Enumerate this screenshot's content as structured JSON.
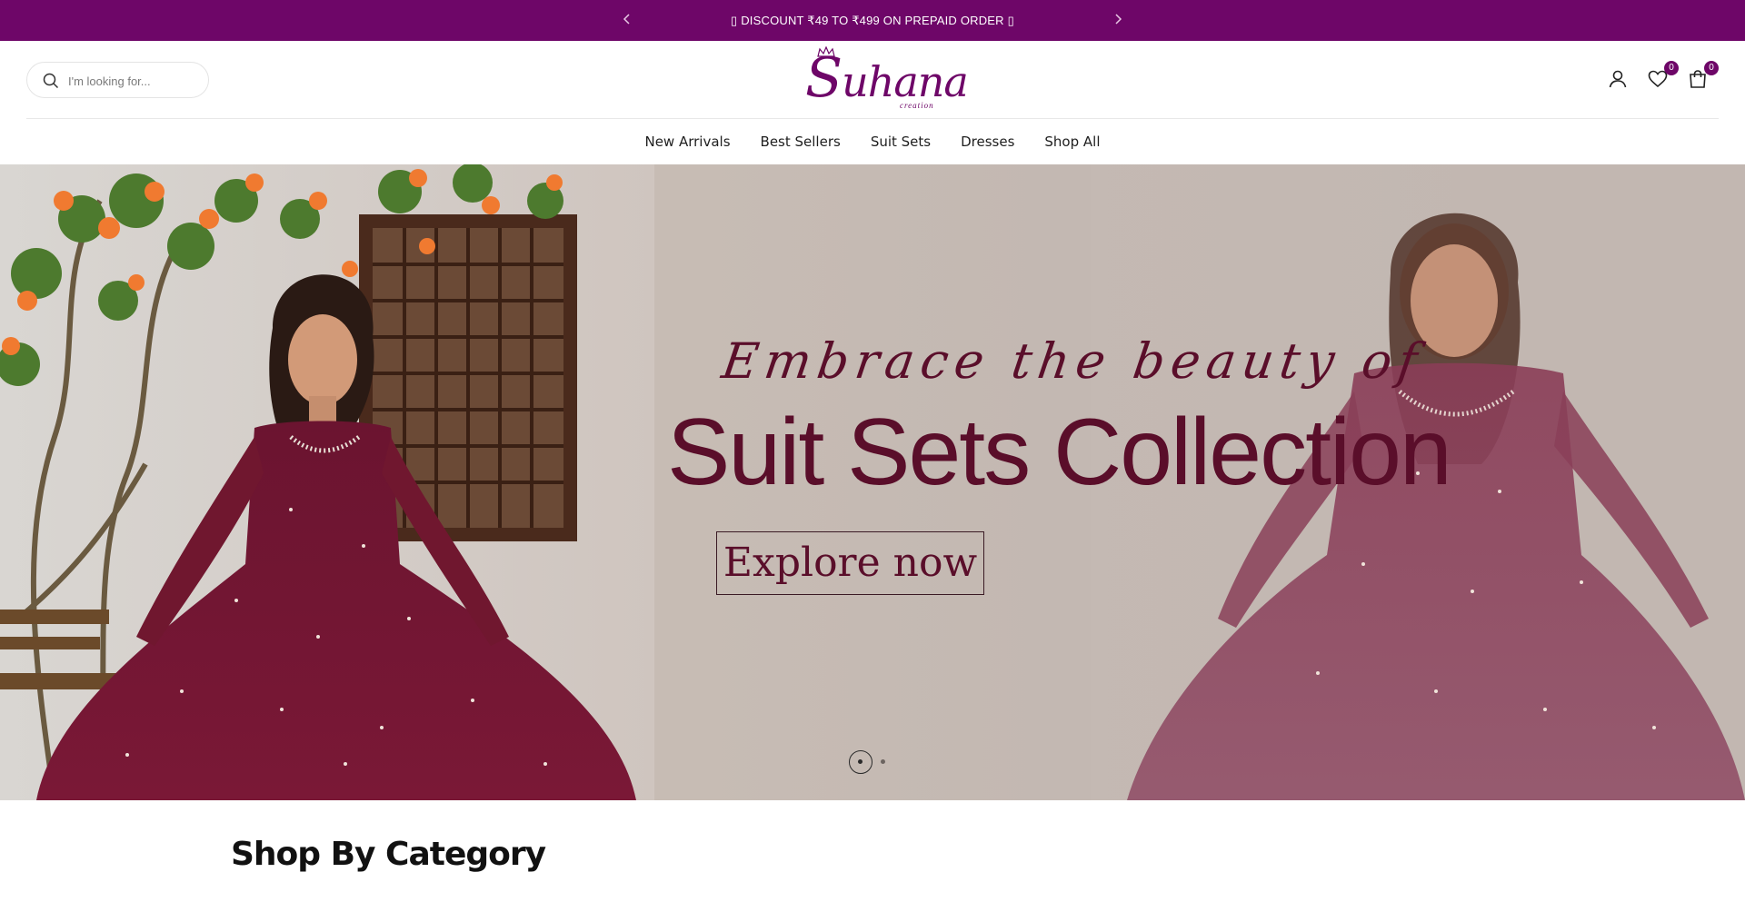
{
  "colors": {
    "brand": "#6e0668",
    "hero_text": "#5a0e2a",
    "hero_bg": "#c7bcb4"
  },
  "announcement": {
    "message": "▯ DISCOUNT ₹49 TO ₹499 ON PREPAID ORDER ▯",
    "prev_icon": "chevron-left-icon",
    "next_icon": "chevron-right-icon"
  },
  "header": {
    "search": {
      "placeholder": "I'm looking for...",
      "value": ""
    },
    "logo": {
      "initial": "S",
      "rest": "uhana",
      "sub": "creation"
    },
    "icons": [
      "account-icon",
      "wishlist-icon",
      "cart-icon"
    ],
    "wishlist_count": "0",
    "cart_count": "0"
  },
  "nav": {
    "items": [
      "New Arrivals",
      "Best Sellers",
      "Suit Sets",
      "Dresses",
      "Shop All"
    ]
  },
  "hero": {
    "tagline": "Embrace the beauty of",
    "headline": "Suit Sets Collection",
    "cta": "Explore now",
    "slide_count": 2,
    "active_slide": 1
  },
  "sections": {
    "category_title": "Shop By Category"
  }
}
